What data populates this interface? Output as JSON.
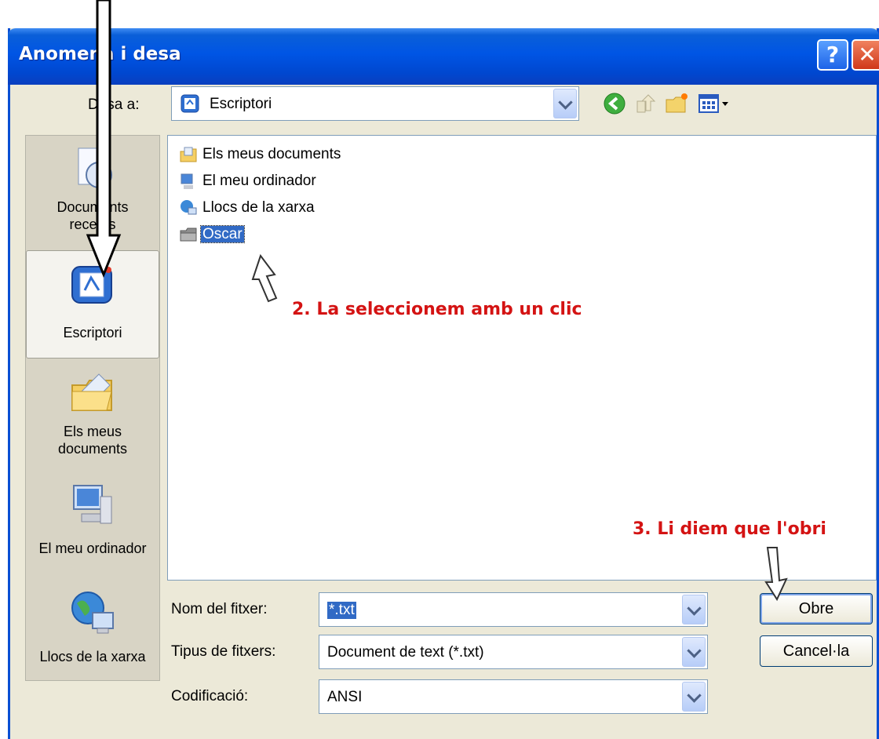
{
  "window": {
    "title": "Anomena i desa",
    "help_symbol": "?",
    "close_symbol": "✕"
  },
  "savein": {
    "label": "Desa a:",
    "value": "Escriptori"
  },
  "places": [
    {
      "label": "Documents recents",
      "icon": "recent-documents-icon"
    },
    {
      "label": "Escriptori",
      "icon": "desktop-icon",
      "selected": true
    },
    {
      "label": "Els meus documents",
      "icon": "my-documents-icon"
    },
    {
      "label": "El meu ordinador",
      "icon": "my-computer-icon"
    },
    {
      "label": "Llocs de la xarxa",
      "icon": "network-places-icon"
    }
  ],
  "files": [
    {
      "label": "Els meus documents",
      "icon": "my-documents-icon"
    },
    {
      "label": "El meu ordinador",
      "icon": "my-computer-icon"
    },
    {
      "label": "Llocs de la xarxa",
      "icon": "network-places-icon"
    },
    {
      "label": "Oscar",
      "icon": "folder-icon",
      "selected": true
    }
  ],
  "fields": {
    "filename_label": "Nom del fitxer:",
    "filename_value": "*.txt",
    "filetype_label": "Tipus de fitxers:",
    "filetype_value": "Document de text (*.txt)",
    "encoding_label": "Codificació:",
    "encoding_value": "ANSI"
  },
  "buttons": {
    "open": "Obre",
    "cancel": "Cancel·la"
  },
  "annotations": {
    "step2": "2. La seleccionem amb un clic",
    "step3": "3. Li diem que l'obri"
  },
  "colors": {
    "title_bar": "#0055e5",
    "selection": "#316ac5",
    "annotation": "#d41313",
    "dialog_bg": "#ece9d8"
  }
}
